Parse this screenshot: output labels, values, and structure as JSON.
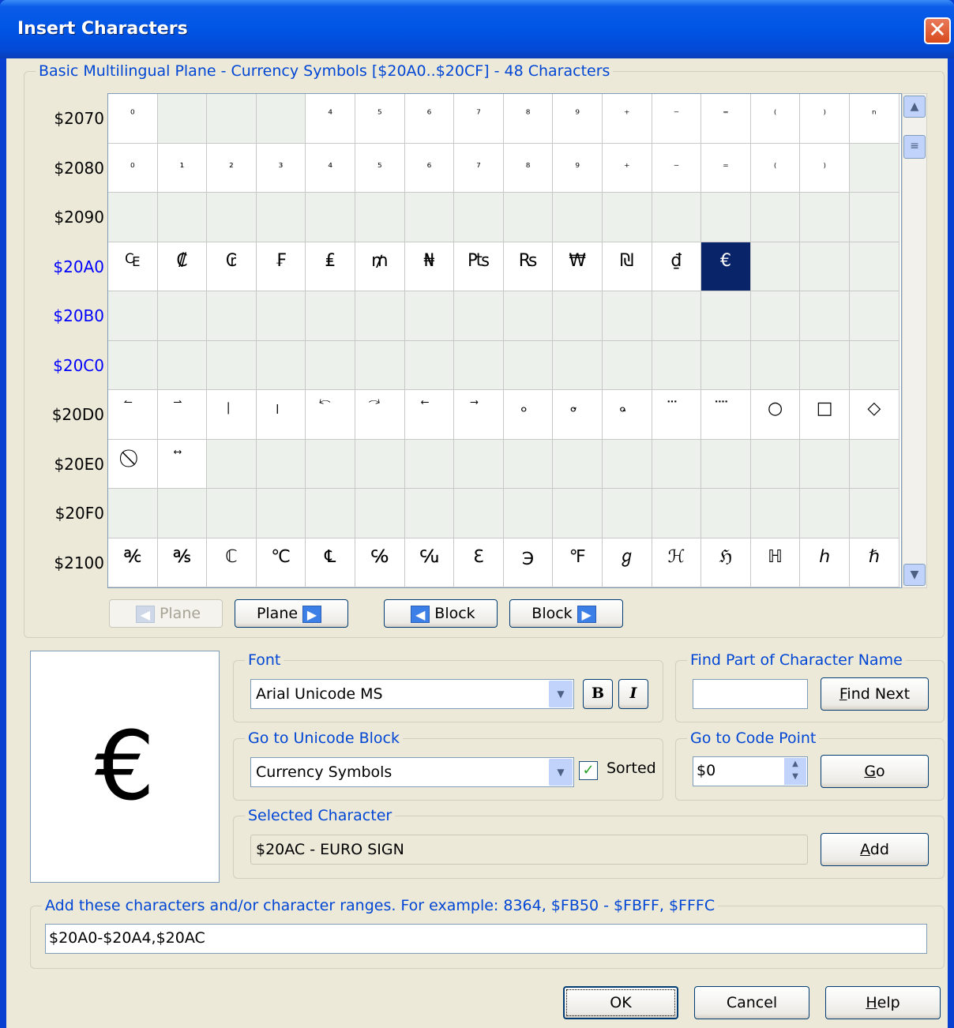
{
  "dialog": {
    "title": "Insert Characters",
    "close_glyph": "✕"
  },
  "charmap": {
    "legend": "Basic Multilingual Plane - Currency Symbols [$20A0..$20CF] - 48 Characters",
    "rows": [
      {
        "label": "$2070",
        "highlight": false,
        "cells": [
          "⁰",
          "",
          "",
          "",
          "⁴",
          "⁵",
          "⁶",
          "⁷",
          "⁸",
          "⁹",
          "⁺",
          "⁻",
          "⁼",
          "⁽",
          "⁾",
          "ⁿ"
        ]
      },
      {
        "label": "$2080",
        "highlight": false,
        "cells": [
          "₀",
          "₁",
          "₂",
          "₃",
          "₄",
          "₅",
          "₆",
          "₇",
          "₈",
          "₉",
          "₊",
          "₋",
          "₌",
          "₍",
          "₎",
          ""
        ]
      },
      {
        "label": "$2090",
        "highlight": false,
        "cells": [
          "",
          "",
          "",
          "",
          "",
          "",
          "",
          "",
          "",
          "",
          "",
          "",
          "",
          "",
          "",
          ""
        ]
      },
      {
        "label": "$20A0",
        "highlight": true,
        "cells": [
          "₠",
          "₡",
          "₢",
          "₣",
          "₤",
          "₥",
          "₦",
          "₧",
          "₨",
          "₩",
          "₪",
          "₫",
          "€",
          "",
          "",
          ""
        ]
      },
      {
        "label": "$20B0",
        "highlight": true,
        "cells": [
          "",
          "",
          "",
          "",
          "",
          "",
          "",
          "",
          "",
          "",
          "",
          "",
          "",
          "",
          "",
          ""
        ]
      },
      {
        "label": "$20C0",
        "highlight": true,
        "cells": [
          "",
          "",
          "",
          "",
          "",
          "",
          "",
          "",
          "",
          "",
          "",
          "",
          "",
          "",
          "",
          ""
        ]
      },
      {
        "label": "$20D0",
        "highlight": false,
        "cells": [
          "⃐",
          "⃑",
          "⃒",
          "⃓",
          "⃔",
          "⃕",
          "⃖",
          "⃗",
          "⃘",
          "⃙",
          "⃚",
          "⃛",
          "⃜",
          "○",
          "□",
          "◇"
        ]
      },
      {
        "label": "$20E0",
        "highlight": false,
        "cells": [
          "⃠",
          "⃡",
          "",
          "",
          "",
          "",
          "",
          "",
          "",
          "",
          "",
          "",
          "",
          "",
          "",
          ""
        ]
      },
      {
        "label": "$20F0",
        "highlight": false,
        "cells": [
          "",
          "",
          "",
          "",
          "",
          "",
          "",
          "",
          "",
          "",
          "",
          "",
          "",
          "",
          "",
          ""
        ]
      },
      {
        "label": "$2100",
        "highlight": false,
        "cells": [
          "℀",
          "℁",
          "ℂ",
          "℃",
          "℄",
          "℅",
          "℆",
          "ℇ",
          "℈",
          "℉",
          "ℊ",
          "ℋ",
          "ℌ",
          "ℍ",
          "ℎ",
          "ℏ"
        ]
      }
    ],
    "selected": {
      "row": 3,
      "col": 12
    }
  },
  "nav": {
    "prev_plane": "Plane",
    "next_plane": "Plane",
    "prev_block": "Block",
    "next_block": "Block"
  },
  "preview": {
    "char": "€"
  },
  "font": {
    "legend": "Font",
    "value": "Arial Unicode MS",
    "bold": "B",
    "italic": "I"
  },
  "find": {
    "legend": "Find Part of Character Name",
    "value": "",
    "button_pre": "",
    "button_u": "F",
    "button_post": "ind Next"
  },
  "block": {
    "legend": "Go to Unicode Block",
    "value": "Currency Symbols",
    "sorted_label": "Sorted",
    "sorted": true
  },
  "codepoint": {
    "legend": "Go to Code Point",
    "value": "$0",
    "button_u": "G",
    "button_post": "o"
  },
  "selected_char": {
    "legend": "Selected Character",
    "value": "$20AC - EURO SIGN",
    "button_u": "A",
    "button_post": "dd"
  },
  "ranges": {
    "legend": "Add these characters and/or character ranges. For example: 8364, $FB50 - $FBFF, $FFFC",
    "value": "$20A0-$20A4,$20AC"
  },
  "footer": {
    "ok": "OK",
    "cancel": "Cancel",
    "help_u": "H",
    "help_post": "elp"
  }
}
